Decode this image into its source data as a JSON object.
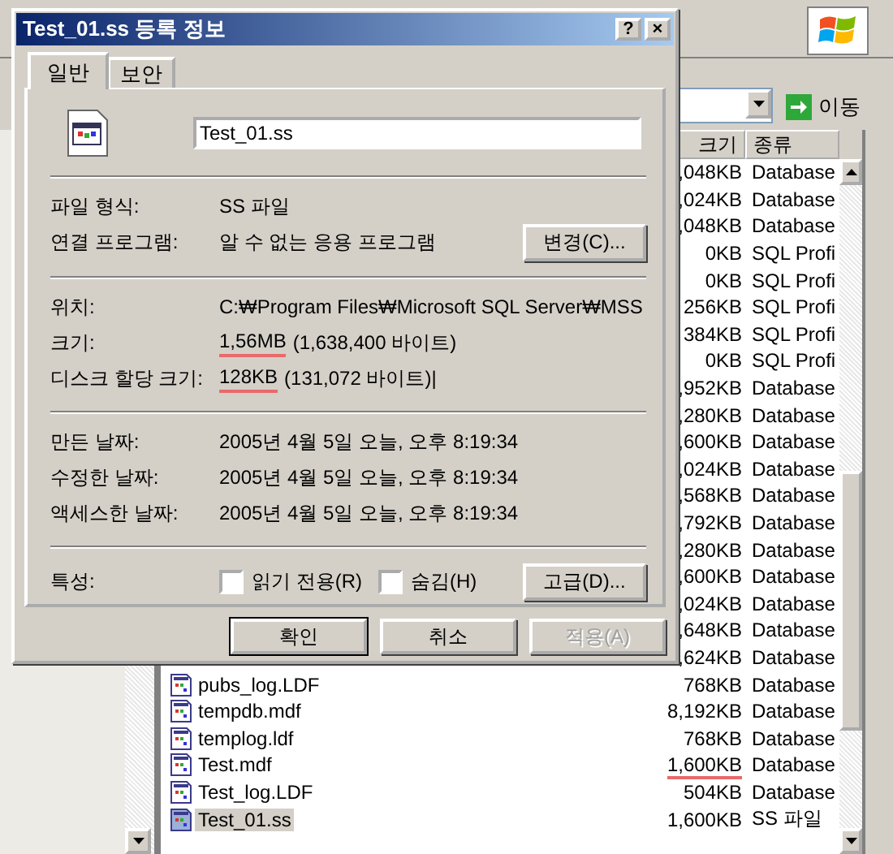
{
  "explorer": {
    "go_button": "이동",
    "columns": [
      "크기",
      "종류"
    ],
    "rows": [
      {
        "size": ",048KB",
        "type": "Database",
        "underlined": false
      },
      {
        "size": ",024KB",
        "type": "Database",
        "underlined": false
      },
      {
        "size": ",048KB",
        "type": "Database",
        "underlined": false
      },
      {
        "size": "0KB",
        "type": "SQL Profi",
        "underlined": false
      },
      {
        "size": "0KB",
        "type": "SQL Profi",
        "underlined": false
      },
      {
        "size": "256KB",
        "type": "SQL Profi",
        "underlined": false
      },
      {
        "size": "384KB",
        "type": "SQL Profi",
        "underlined": false
      },
      {
        "size": "0KB",
        "type": "SQL Profi",
        "underlined": false
      },
      {
        "size": ",952KB",
        "type": "Database",
        "underlined": false
      },
      {
        "size": ",280KB",
        "type": "Database",
        "underlined": false
      },
      {
        "size": ",600KB",
        "type": "Database",
        "underlined": false
      },
      {
        "size": ",024KB",
        "type": "Database",
        "underlined": false
      },
      {
        "size": ",568KB",
        "type": "Database",
        "underlined": false
      },
      {
        "size": ",792KB",
        "type": "Database",
        "underlined": false
      },
      {
        "size": ",280KB",
        "type": "Database",
        "underlined": false
      },
      {
        "size": ",600KB",
        "type": "Database",
        "underlined": false
      },
      {
        "size": ",024KB",
        "type": "Database",
        "underlined": false
      },
      {
        "size": ",648KB",
        "type": "Database",
        "underlined": false
      },
      {
        "size": ",624KB",
        "type": "Database",
        "underlined": false
      },
      {
        "name": "pubs_log.LDF",
        "size": "768KB",
        "type": "Database",
        "selected": false,
        "underlined": false
      },
      {
        "name": "tempdb.mdf",
        "size": "8,192KB",
        "type": "Database",
        "selected": false,
        "underlined": false
      },
      {
        "name": "templog.ldf",
        "size": "768KB",
        "type": "Database",
        "selected": false,
        "underlined": false
      },
      {
        "name": "Test.mdf",
        "size": "1,600KB",
        "type": "Database",
        "selected": false,
        "underlined": true
      },
      {
        "name": "Test_log.LDF",
        "size": "504KB",
        "type": "Database",
        "selected": false,
        "underlined": false
      },
      {
        "name": "Test_01.ss",
        "size": "1,600KB",
        "type": "SS 파일",
        "selected": true,
        "underlined": false
      }
    ]
  },
  "dialog": {
    "title": "Test_01.ss 등록 정보",
    "title_buttons": [
      "?",
      "×"
    ],
    "tabs": [
      {
        "label": "일반",
        "selected": true
      },
      {
        "label": "보안",
        "selected": false
      }
    ],
    "file_name": "Test_01.ss",
    "sections": [
      [
        {
          "label": "파일 형식:",
          "value": "SS 파일"
        },
        {
          "label": "연결 프로그램:",
          "value": "알 수 없는 응용 프로그램",
          "button": "변경(C)..."
        }
      ],
      [
        {
          "label": "위치:",
          "value": "C:₩Program Files₩Microsoft SQL Server₩MSS"
        },
        {
          "label": "크기:",
          "value": "1,56MB",
          "detail": "(1,638,400 바이트)",
          "underlined": true
        },
        {
          "label": "디스크 할당 크기:",
          "value": "128KB",
          "detail": "(131,072 바이트)|",
          "underlined": true
        }
      ],
      [
        {
          "label": "만든 날짜:",
          "value": "2005년 4월 5일 오늘, 오후 8:19:34"
        },
        {
          "label": "수정한 날짜:",
          "value": "2005년 4월 5일 오늘, 오후 8:19:34"
        },
        {
          "label": "액세스한 날짜:",
          "value": "2005년 4월 5일 오늘, 오후 8:19:34"
        }
      ]
    ],
    "attributes_label": "특성:",
    "attributes": [
      {
        "label": "읽기 전용(R)",
        "checked": false
      },
      {
        "label": "숨김(H)",
        "checked": false
      }
    ],
    "advanced_button": "고급(D)...",
    "buttons": [
      {
        "label": "확인",
        "default": true,
        "disabled": false
      },
      {
        "label": "취소",
        "default": false,
        "disabled": false
      },
      {
        "label": "적용(A)",
        "default": false,
        "disabled": true
      }
    ]
  }
}
